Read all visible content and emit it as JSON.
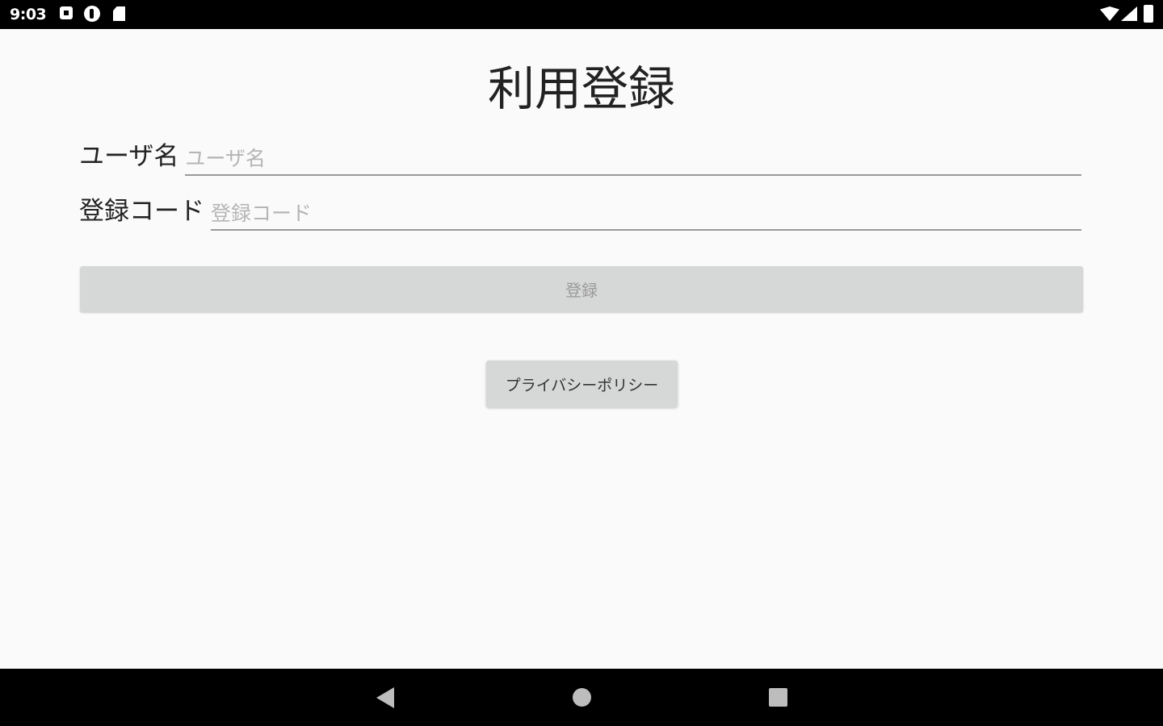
{
  "status_bar": {
    "time": "9:03",
    "icons": [
      "notification-icon",
      "notification-icon",
      "sd-card-icon",
      "wifi-icon",
      "signal-icon",
      "battery-icon"
    ]
  },
  "title": "利用登録",
  "form": {
    "username": {
      "label": "ユーザ名",
      "placeholder": "ユーザ名",
      "value": ""
    },
    "registration_code": {
      "label": "登録コード",
      "placeholder": "登録コード",
      "value": ""
    }
  },
  "register_button": {
    "label": "登録",
    "enabled": false
  },
  "privacy_button": {
    "label": "プライバシーポリシー"
  },
  "nav_bar": {
    "icons": [
      "back-icon",
      "home-icon",
      "recents-icon"
    ]
  },
  "colors": {
    "background": "#fafafa",
    "button_bg": "#d6d7d7",
    "disabled_text": "#9a9a9a",
    "bars": "#000000"
  }
}
